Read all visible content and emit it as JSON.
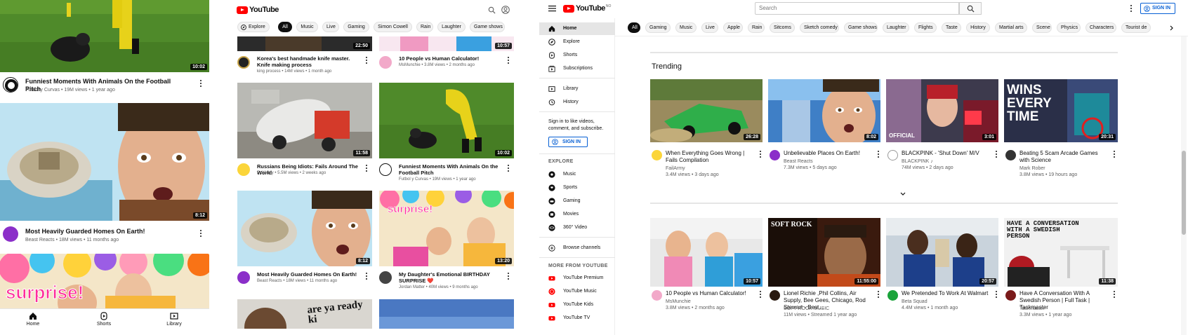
{
  "panel1": {
    "videos": [
      {
        "title": "Funniest Moments With Animals On the Football Pitch",
        "meta": "Futbol y Curvas • 19M views • 1 year ago",
        "duration": "10:02"
      },
      {
        "title": "Most Heavily Guarded Homes On Earth!",
        "meta": "Beast Reacts • 18M views • 11 months ago",
        "duration": "8:12"
      },
      {
        "title": "",
        "meta": "",
        "duration": "",
        "overlay": "surprise!"
      }
    ],
    "bottom_nav": [
      {
        "label": "Home"
      },
      {
        "label": "Shorts"
      },
      {
        "label": "Library"
      }
    ]
  },
  "panel2": {
    "logo": "YouTube",
    "chips": [
      "Explore",
      "All",
      "Music",
      "Live",
      "Gaming",
      "Simon Cowell",
      "Rain",
      "Laughter",
      "Game shows"
    ],
    "videos": [
      {
        "title": "Korea's best handmade knife master. Knife making process",
        "meta": "king process • 14M views • 1 month ago",
        "duration": "22:50"
      },
      {
        "title": "10 People vs Human Calculator!",
        "meta": "MsMunchie • 3.8M views • 2 months ago",
        "duration": "10:57"
      },
      {
        "title": "Russians Being Idiots: Fails Around The World",
        "meta": "FailArmy • 5.5M views • 2 weeks ago",
        "duration": "11:58"
      },
      {
        "title": "Funniest Moments With Animals On the Football Pitch",
        "meta": "Futbol y Curvas • 19M views • 1 year ago",
        "duration": "10:02"
      },
      {
        "title": "Most Heavily Guarded Homes On Earth!",
        "meta": "Beast Reacts • 18M views • 11 months ago",
        "duration": "8:12"
      },
      {
        "title": "My Daughter's Emotional BIRTHDAY SURPRISE ❤️",
        "meta": "Jordan Matter • 40M views • 9 months ago",
        "duration": "13:20",
        "overlay": "surprise!"
      },
      {
        "overlay": "are ya ready ki"
      }
    ]
  },
  "panel3": {
    "logo": "YouTube",
    "logo_sup": "NO",
    "search_placeholder": "Search",
    "sign_in": "SIGN IN",
    "sidebar": {
      "main": [
        {
          "label": "Home"
        },
        {
          "label": "Explore"
        },
        {
          "label": "Shorts"
        },
        {
          "label": "Subscriptions"
        }
      ],
      "lib": [
        {
          "label": "Library"
        },
        {
          "label": "History"
        }
      ],
      "signin_prompt": "Sign in to like videos, comment, and subscribe.",
      "sign_in": "SIGN IN",
      "explore_header": "EXPLORE",
      "explore": [
        {
          "label": "Music"
        },
        {
          "label": "Sports"
        },
        {
          "label": "Gaming"
        },
        {
          "label": "Movies"
        },
        {
          "label": "360° Video"
        }
      ],
      "browse": "Browse channels",
      "more_header": "MORE FROM YOUTUBE",
      "more": [
        {
          "label": "YouTube Premium"
        },
        {
          "label": "YouTube Music"
        },
        {
          "label": "YouTube Kids"
        },
        {
          "label": "YouTube TV"
        }
      ]
    },
    "chips": [
      "All",
      "Gaming",
      "Music",
      "Live",
      "Apple",
      "Rain",
      "Sitcoms",
      "Sketch comedy",
      "Game shows",
      "Laughter",
      "Flights",
      "Taste",
      "History",
      "Martial arts",
      "Scene",
      "Physics",
      "Characters",
      "Tourist de"
    ],
    "trending_header": "Trending",
    "trending": [
      {
        "title": "When Everything Goes Wrong | Fails Compilation",
        "channel": "FailArmy",
        "meta": "3.4M views • 3 days ago",
        "duration": "26:28"
      },
      {
        "title": "Unbelievable Places On Earth!",
        "channel": "Beast Reacts",
        "meta": "7.3M views • 5 days ago",
        "duration": "8:02"
      },
      {
        "title": "BLACKPINK - 'Shut Down' M/V",
        "channel": "BLACKPINK ♪",
        "meta": "74M views • 2 days ago",
        "duration": "3:01",
        "overlay": "OFFICIAL"
      },
      {
        "title": "Beating 5 Scam Arcade Games with Science",
        "channel": "Mark Rober",
        "meta": "3.8M views • 19 hours ago",
        "duration": "20:31",
        "overlay": "WINS EVERY TIME"
      }
    ],
    "row2": [
      {
        "title": "10 People vs Human Calculator!",
        "channel": "MsMunchie",
        "meta": "3.8M views • 2 months ago",
        "duration": "10:57"
      },
      {
        "title": "Lionel Richie ,Phil Collins, Air Supply, Bee Gees, Chicago, Rod Stewart - Best...",
        "channel": "SOFT ROCK MUSIC",
        "meta": "11M views • Streamed 1 year ago",
        "duration": "11:55:00",
        "overlay": "SOFT ROCK"
      },
      {
        "title": "We Pretended To Work At Walmart",
        "channel": "Beta Squad",
        "meta": "4.4M views • 1 month ago",
        "duration": "20:57"
      },
      {
        "title": "Have A Conversation With A Swedish Person | Full Task | Taskmaster",
        "channel": "Taskmaster",
        "meta": "3.3M views • 1 year ago",
        "duration": "11:38",
        "overlay": "HAVE A CONVERSATION WITH A SWEDISH PERSON"
      }
    ]
  }
}
